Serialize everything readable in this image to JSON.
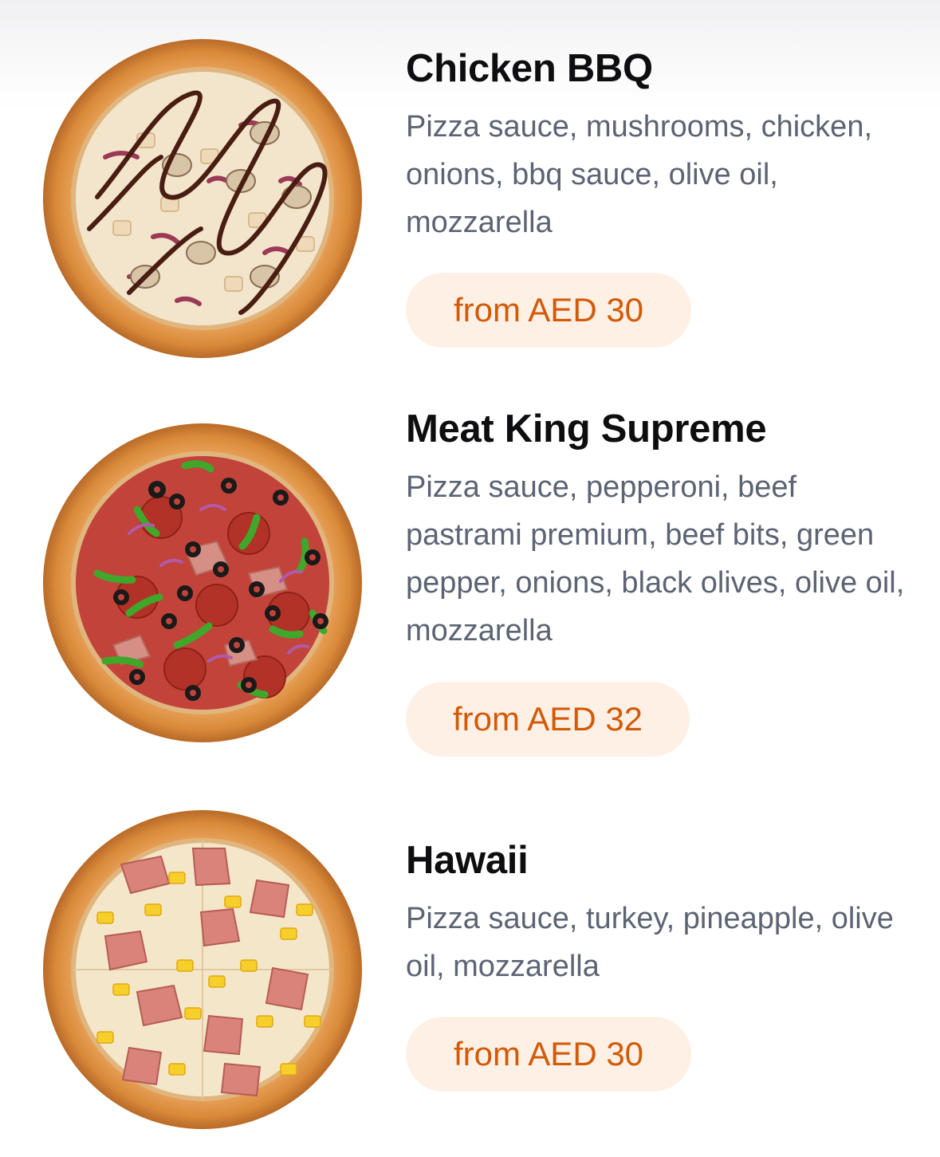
{
  "menu": {
    "items": [
      {
        "name": "Chicken BBQ",
        "description": "Pizza sauce, mushrooms, chicken, onions, bbq sauce, olive oil, mozzarella",
        "price_label": "from AED 30"
      },
      {
        "name": "Meat King Supreme",
        "description": "Pizza sauce, pepperoni, beef pastrami premium, beef bits, green pepper, onions, black olives, olive oil, mozzarella",
        "price_label": "from AED 32"
      },
      {
        "name": "Hawaii",
        "description": "Pizza sauce, turkey, pineapple, olive oil, mozzarella",
        "price_label": "from AED 30"
      }
    ]
  },
  "colors": {
    "title": "#0e0e10",
    "description": "#5c6373",
    "price_text": "#d25a06",
    "price_background": "#fff0e6"
  }
}
